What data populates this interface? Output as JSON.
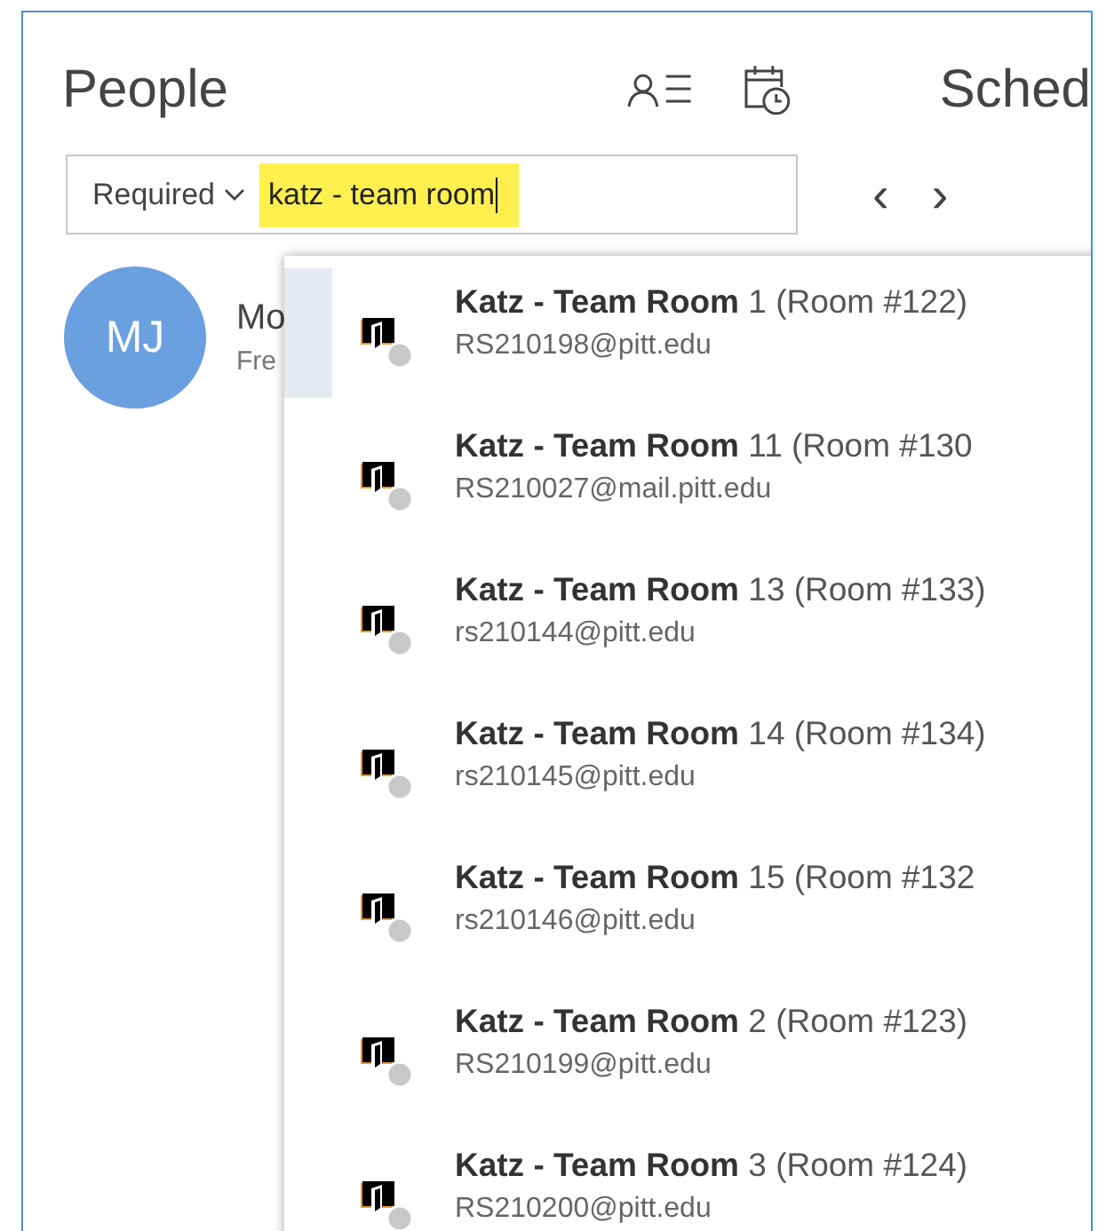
{
  "header": {
    "title": "People",
    "schedule_title": "Sched"
  },
  "attendee_search": {
    "type_dropdown": "Required",
    "value": "katz - team room"
  },
  "nav": {
    "previous": "‹",
    "next": "›"
  },
  "attendee": {
    "initials": "MJ",
    "name": "Mo",
    "status": "Fre"
  },
  "suggestions": [
    {
      "name": "**Katz - Team Room** 1 (Room #122)",
      "email": "RS210198@pitt.edu",
      "selected": true
    },
    {
      "name": "**Katz - Team Room** 11 (Room #130",
      "email": "RS210027@mail.pitt.edu",
      "selected": false
    },
    {
      "name": "**Katz - Team Room** 13 (Room #133)",
      "email": "rs210144@pitt.edu",
      "selected": false
    },
    {
      "name": "**Katz - Team Room** 14 (Room #134)",
      "email": "rs210145@pitt.edu",
      "selected": false
    },
    {
      "name": "**Katz - Team Room** 15 (Room #132",
      "email": "rs210146@pitt.edu",
      "selected": false
    },
    {
      "name": "**Katz - Team Room** 2 (Room #123)",
      "email": "RS210199@pitt.edu",
      "selected": false
    },
    {
      "name": "**Katz - Team Room** 3 (Room #124)",
      "email": "RS210200@pitt.edu",
      "selected": false
    }
  ]
}
